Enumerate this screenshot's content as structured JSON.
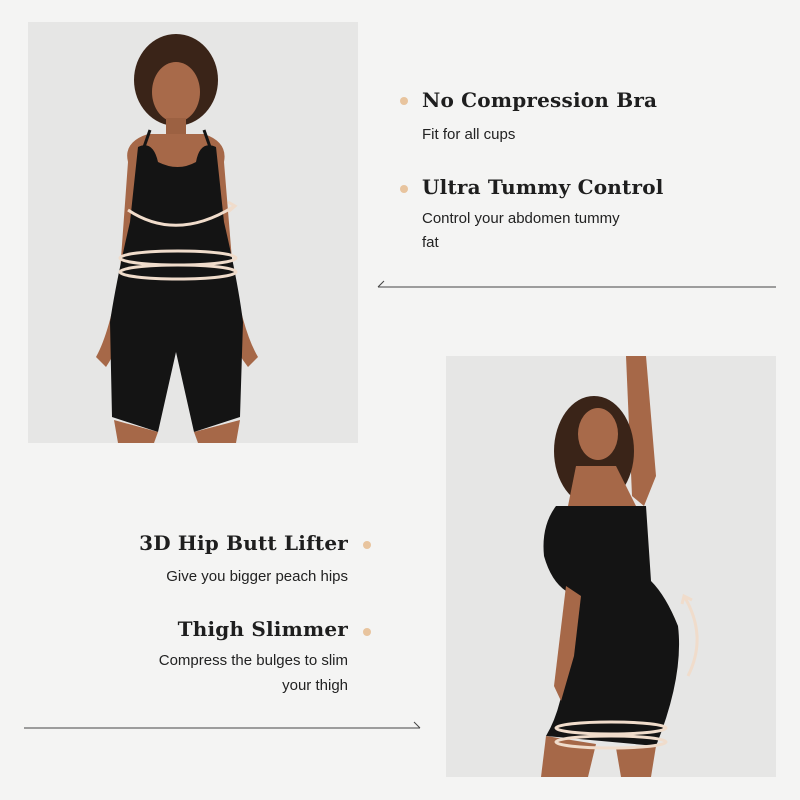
{
  "colors": {
    "background": "#f4f4f3",
    "photo_background": "#e6e6e5",
    "garment": "#141414",
    "accent_dot": "#e8c49e",
    "arrow": "#f0dccb",
    "divider": "#444444"
  },
  "features_top": [
    {
      "title": "No Compression Bra",
      "desc": "Fit for all cups"
    },
    {
      "title": "Ultra Tummy Control",
      "desc_line1": "Control your abdomen tummy",
      "desc_line2": "fat"
    }
  ],
  "features_bottom": [
    {
      "title": "3D Hip Butt Lifter",
      "desc": "Give you bigger peach hips"
    },
    {
      "title": "Thigh Slimmer",
      "desc_line1": "Compress the bulges to slim",
      "desc_line2": "your thigh"
    }
  ],
  "images": {
    "front_model_icon": "model-front-photo",
    "side_model_icon": "model-side-photo"
  }
}
